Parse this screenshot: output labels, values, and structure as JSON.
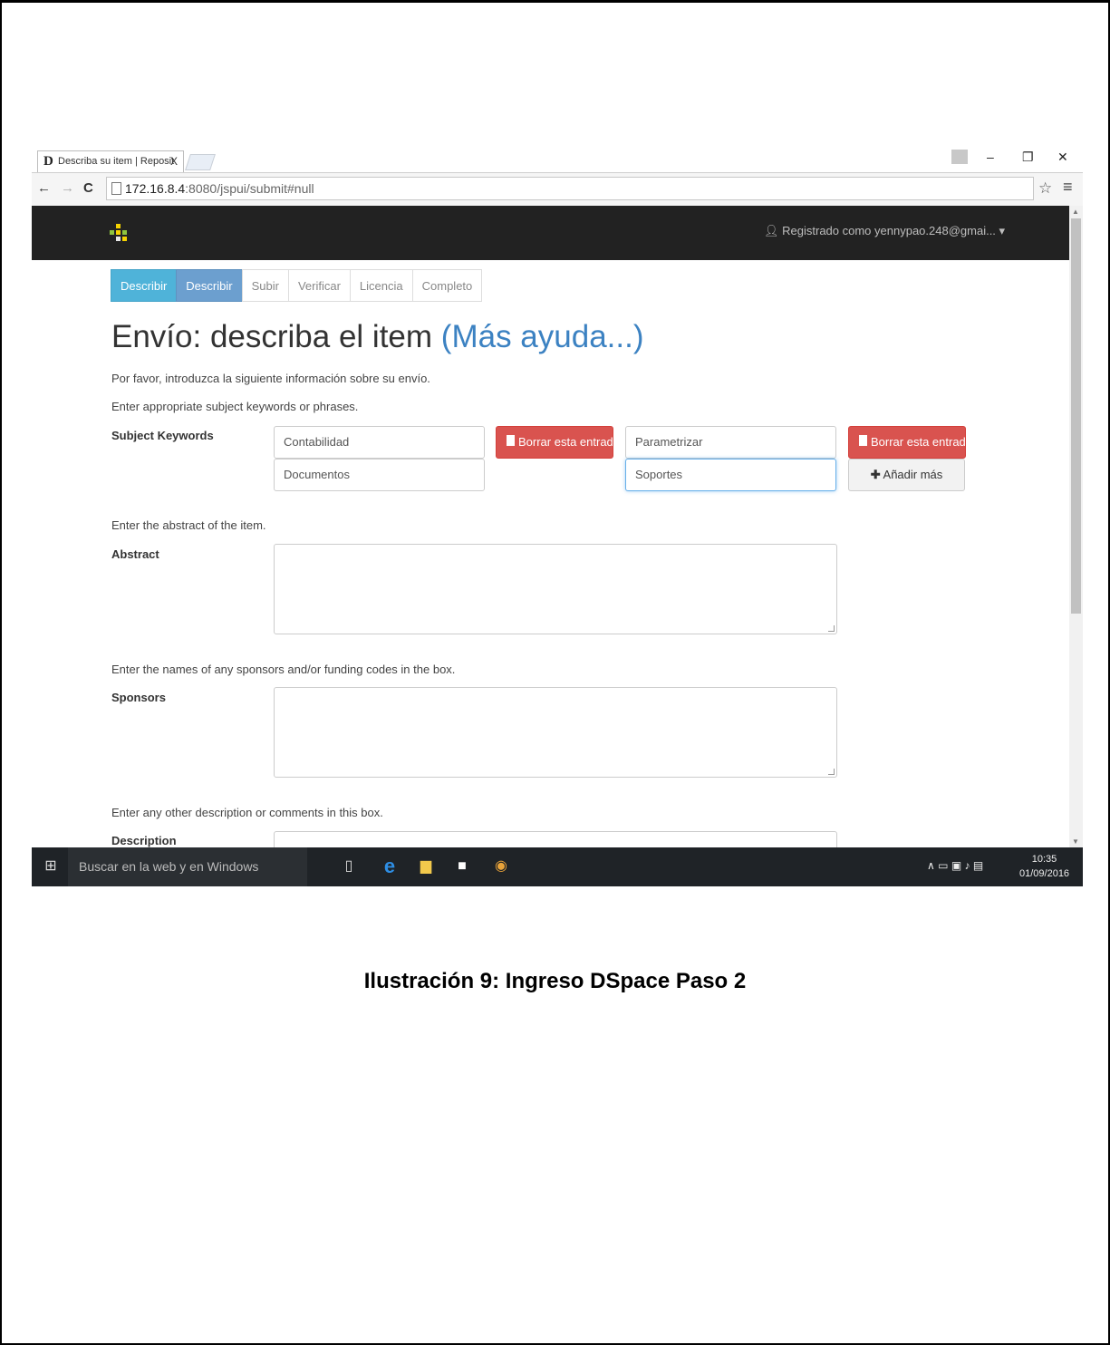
{
  "browser": {
    "tab_title": "Describa su item | Reposit",
    "tab_close": "X",
    "url_host": "172.16.8.4",
    "url_path": ":8080/jspui/submit#null"
  },
  "navbar": {
    "user_label": "Registrado como yennypao.248@gmai..."
  },
  "steps": [
    "Describir",
    "Describir",
    "Subir",
    "Verificar",
    "Licencia",
    "Completo"
  ],
  "heading": {
    "title": "Envío: describa el item",
    "help": "(Más ayuda...)"
  },
  "intro": "Por favor, introduzca la siguiente información sobre su envío.",
  "keywords": {
    "hint": "Enter appropriate subject keywords or phrases.",
    "label": "Subject Keywords",
    "values": [
      "Contabilidad",
      "Parametrizar",
      "Documentos",
      "Soportes"
    ],
    "delete_label": "Borrar esta entrada",
    "add_label": "Añadir más"
  },
  "abstract": {
    "hint": "Enter the abstract of the item.",
    "label": "Abstract"
  },
  "sponsors": {
    "hint": "Enter the names of any sponsors and/or funding codes in the box.",
    "label": "Sponsors"
  },
  "description": {
    "hint": "Enter any other description or comments in this box.",
    "label": "Description"
  },
  "taskbar": {
    "search": "Buscar en la web y en Windows",
    "time": "10:35",
    "date": "01/09/2016"
  },
  "caption": "Ilustración 9: Ingreso DSpace Paso 2",
  "colors": {
    "navbar": "#222222",
    "step_active": "#4fb3d9",
    "danger": "#d9534f",
    "link": "#3c82c2"
  }
}
